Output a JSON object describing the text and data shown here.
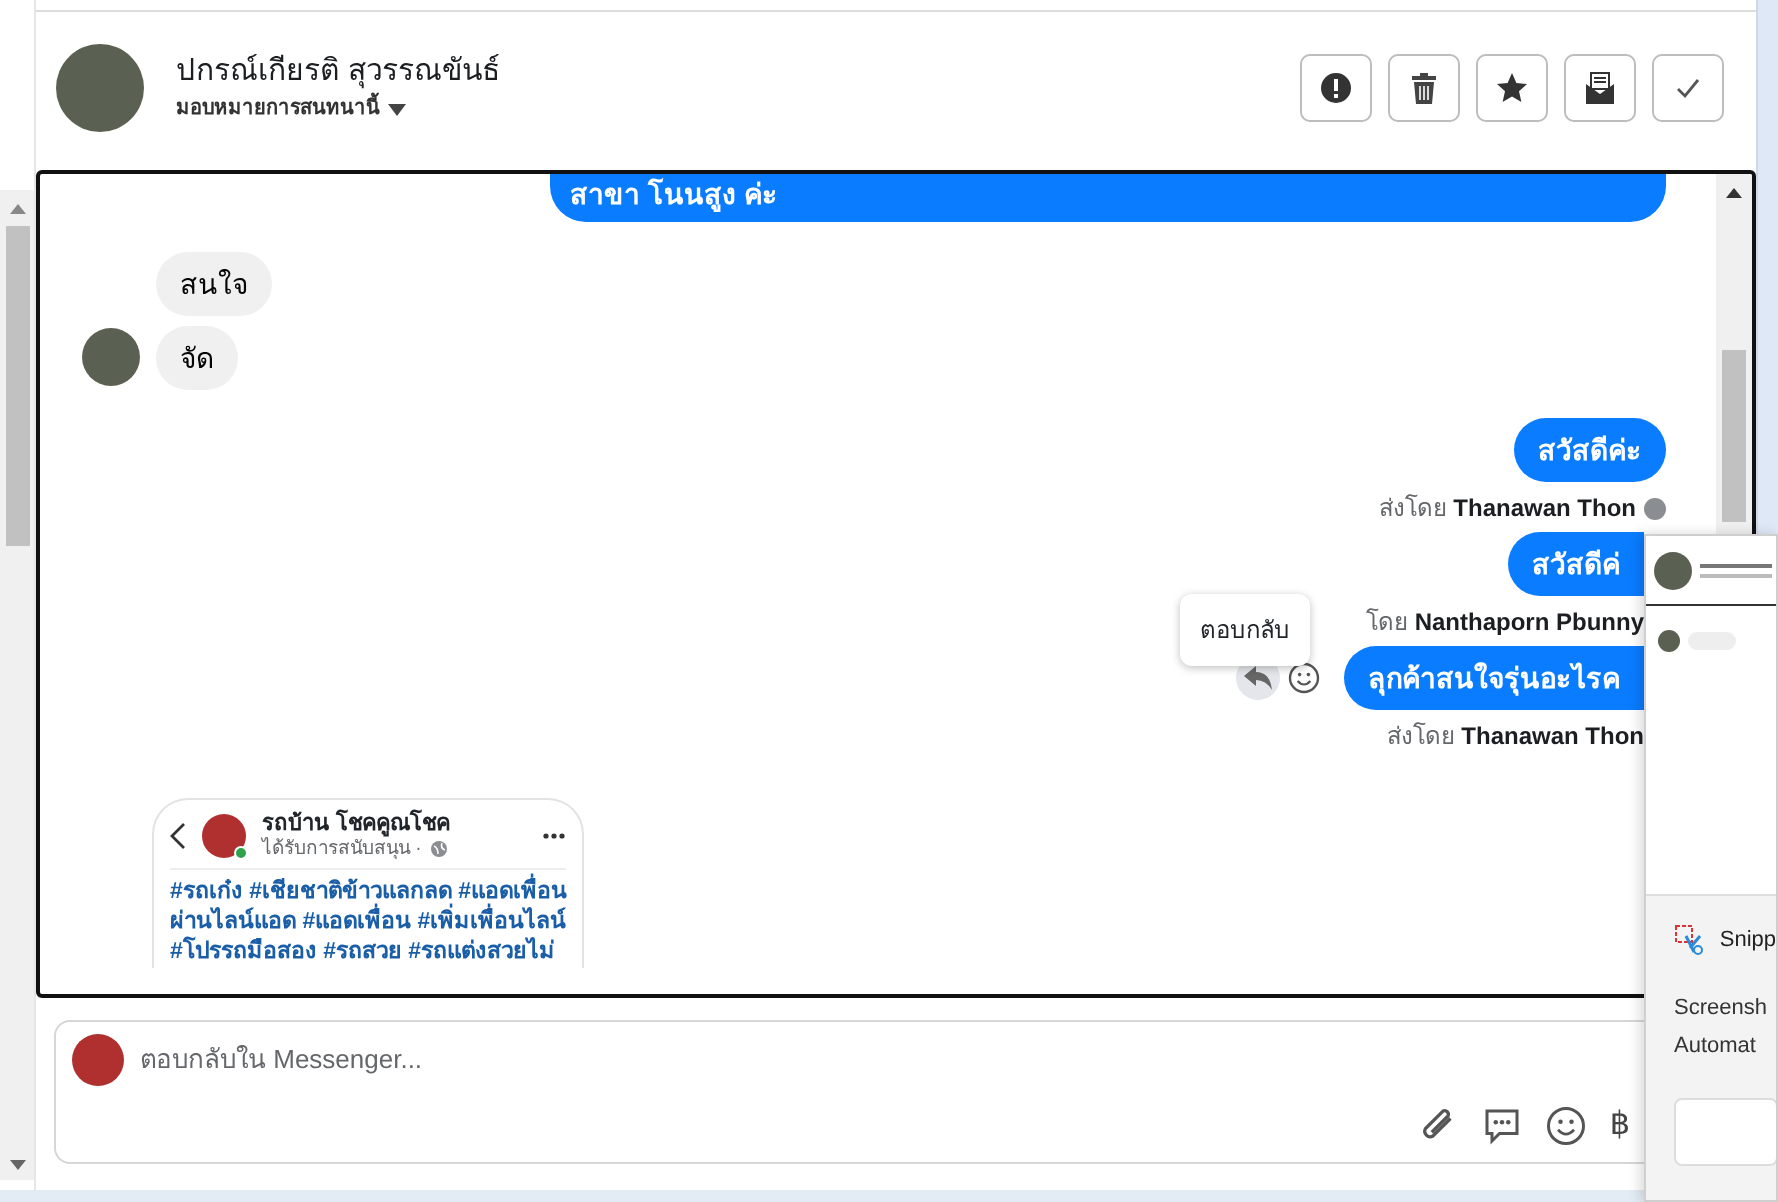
{
  "contact": {
    "name": "ปกรณ์เกียรติ สุวรรณขันธ์",
    "assign_label": "มอบหมายการสนทนานี้"
  },
  "header_actions": [
    {
      "kind": "alert"
    },
    {
      "kind": "delete"
    },
    {
      "kind": "star"
    },
    {
      "kind": "mail"
    },
    {
      "kind": "done"
    }
  ],
  "messages": [
    {
      "kind": "outgoing",
      "text": "สาขา โนนสูง ค่ะ",
      "cut_top": true
    },
    {
      "kind": "incoming",
      "text": "สนใจ",
      "avatar": false
    },
    {
      "kind": "incoming",
      "text": "จัด",
      "avatar": true
    },
    {
      "kind": "outgoing",
      "text": "สวัสดีค่ะ",
      "sent_by": "ส่งโดย **Thanawan Thon**",
      "help": true
    },
    {
      "kind": "outgoing",
      "text": "สวัสดีค่",
      "sent_by": "โดย **Nanthaporn Pbunny**",
      "covered": true
    },
    {
      "kind": "outgoing",
      "text": "ลุกค้าสนใจรุ่นอะไรค",
      "sent_by": "ส่งโดย **Thanawan Thon**",
      "covered": true,
      "hovered": true,
      "tooltip": "ตอบกลับ"
    }
  ],
  "post_card": {
    "page_name": "รถบ้าน โชคคูณโชค",
    "sponsored": "ได้รับการสนับสนุน ·",
    "online": true,
    "lines": [
      "#รถเก๋ง #เชียชาติข้าวแลกลด #แอดเพื่อน",
      "ผ่านไลน์แอด #แอดเพื่อน #เพิ่มเพื่อนไลน์",
      "#โปรรถมือสอง #รถสวย #รถแต่งสวยไม่"
    ]
  },
  "composer": {
    "placeholder": "ตอบกลับใน Messenger...",
    "tools": [
      {
        "kind": "attach"
      },
      {
        "kind": "chat"
      },
      {
        "kind": "emoji"
      },
      {
        "kind": "text",
        "text": "฿"
      }
    ]
  },
  "notification": {
    "app": "Snipp",
    "lines": [
      "Screensh",
      "Automat"
    ]
  }
}
